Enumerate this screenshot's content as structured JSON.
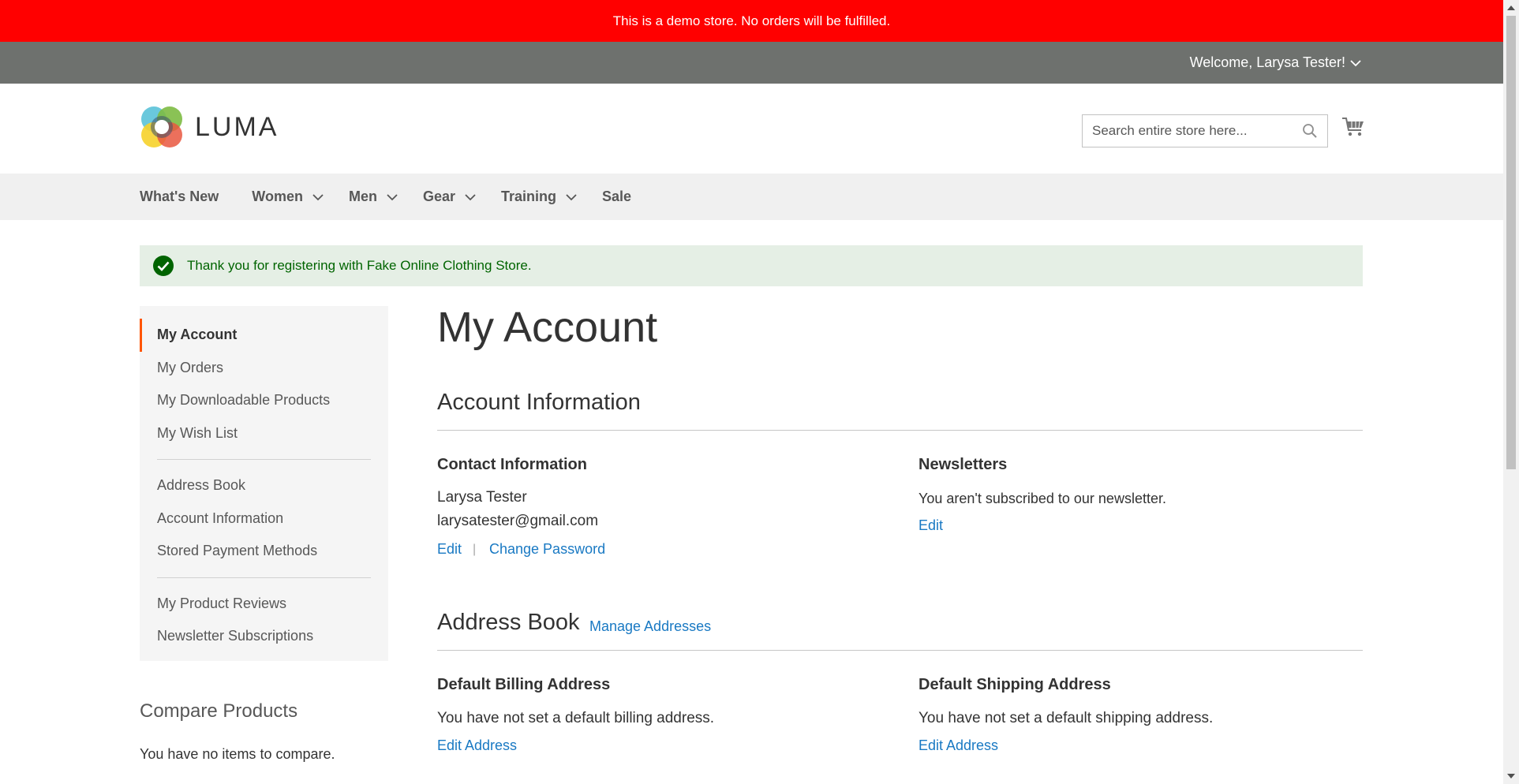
{
  "demo_notice": "This is a demo store. No orders will be fulfilled.",
  "header": {
    "welcome": "Welcome, Larysa Tester!",
    "logo_text": "LUMA",
    "search_placeholder": "Search entire store here..."
  },
  "nav": {
    "items": [
      {
        "label": "What's New",
        "has_submenu": false
      },
      {
        "label": "Women",
        "has_submenu": true
      },
      {
        "label": "Men",
        "has_submenu": true
      },
      {
        "label": "Gear",
        "has_submenu": true
      },
      {
        "label": "Training",
        "has_submenu": true
      },
      {
        "label": "Sale",
        "has_submenu": false
      }
    ]
  },
  "message": "Thank you for registering with Fake Online Clothing Store.",
  "sidebar": {
    "group1": [
      "My Account",
      "My Orders",
      "My Downloadable Products",
      "My Wish List"
    ],
    "group2": [
      "Address Book",
      "Account Information",
      "Stored Payment Methods"
    ],
    "group3": [
      "My Product Reviews",
      "Newsletter Subscriptions"
    ],
    "active": "My Account"
  },
  "compare": {
    "title": "Compare Products",
    "empty_text": "You have no items to compare."
  },
  "main": {
    "page_title": "My Account",
    "account_info": {
      "title": "Account Information",
      "contact": {
        "title": "Contact Information",
        "name": "Larysa Tester",
        "email": "larysatester@gmail.com",
        "edit_label": "Edit",
        "separator": "|",
        "change_password_label": "Change Password"
      },
      "newsletters": {
        "title": "Newsletters",
        "text": "You aren't subscribed to our newsletter.",
        "edit_label": "Edit"
      }
    },
    "address_book": {
      "title": "Address Book",
      "manage_label": "Manage Addresses",
      "billing": {
        "title": "Default Billing Address",
        "text": "You have not set a default billing address.",
        "edit_label": "Edit Address"
      },
      "shipping": {
        "title": "Default Shipping Address",
        "text": "You have not set a default shipping address.",
        "edit_label": "Edit Address"
      }
    }
  },
  "colors": {
    "demo_bar": "#ff0000",
    "panel_header": "#6e716e",
    "link": "#1979c3",
    "active_accent": "#ff5501",
    "success_bg": "#e5efe5",
    "success_text": "#006400"
  }
}
